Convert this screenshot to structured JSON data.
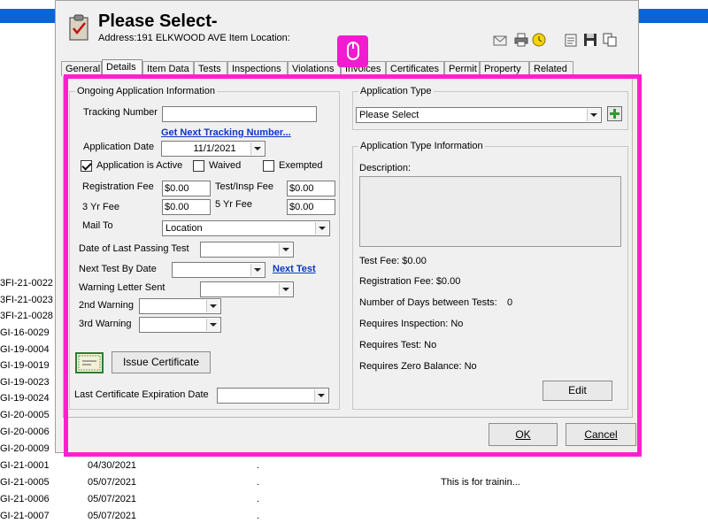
{
  "dialog": {
    "title": "Please Select-",
    "address_line": "Address:191 ELKWOOD AVE Item Location:",
    "tabs": [
      "General",
      "Details",
      "Item Data",
      "Tests",
      "Inspections",
      "Violations",
      "Invoices",
      "Certificates",
      "Permit",
      "Property",
      "Related"
    ],
    "active_tab": "Details",
    "ok_label": "OK",
    "cancel_label": "Cancel"
  },
  "ongoing": {
    "legend": "Ongoing Application Information",
    "tracking_number_label": "Tracking Number",
    "tracking_number_value": "",
    "next_tracking_link": "Get Next Tracking Number...",
    "application_date_label": "Application Date",
    "application_date_value": "11/1/2021",
    "active_label": "Application is Active",
    "active_checked": true,
    "waived_label": "Waived",
    "exempted_label": "Exempted",
    "registration_fee_label": "Registration Fee",
    "registration_fee_value": "$0.00",
    "test_insp_fee_label": "Test/Insp  Fee",
    "test_insp_fee_value": "$0.00",
    "three_yr_fee_label": "3 Yr Fee",
    "three_yr_fee_value": "$0.00",
    "five_yr_fee_label": "5 Yr Fee",
    "five_yr_fee_value": "$0.00",
    "mail_to_label": "Mail To",
    "mail_to_value": "Location",
    "last_passing_label": "Date of Last Passing Test",
    "next_test_label": "Next Test By Date",
    "next_test_link": "Next Test",
    "warning_letter_label": "Warning Letter Sent",
    "second_warning_label": "2nd Warning",
    "third_warning_label": "3rd Warning",
    "issue_certificate_label": "Issue Certificate",
    "last_cert_exp_label": "Last Certificate Expiration Date"
  },
  "app_type": {
    "legend": "Application Type",
    "value": "Please Select"
  },
  "app_type_info": {
    "legend": "Application Type Information",
    "description_label": "Description:",
    "test_fee": "Test Fee: $0.00",
    "registration_fee": "Registration Fee:  $0.00",
    "days_between": "Number of Days between Tests:",
    "days_between_value": "0",
    "requires_inspection": "Requires Inspection:  No",
    "requires_test": "Requires Test: No",
    "requires_zero_balance": "Requires Zero Balance: No",
    "edit_label": "Edit"
  },
  "background_rows": [
    {
      "id": "3FI-21-0022",
      "date": "",
      "dot": "",
      "note": ""
    },
    {
      "id": "3FI-21-0023",
      "date": "",
      "dot": "",
      "note": ""
    },
    {
      "id": "3FI-21-0028",
      "date": "",
      "dot": "",
      "note": ""
    },
    {
      "id": "GI-16-0029",
      "date": "",
      "dot": "",
      "note": ""
    },
    {
      "id": "GI-19-0004",
      "date": "",
      "dot": "",
      "note": ""
    },
    {
      "id": "GI-19-0019",
      "date": "",
      "dot": "",
      "note": ""
    },
    {
      "id": "GI-19-0023",
      "date": "",
      "dot": "",
      "note": ""
    },
    {
      "id": "GI-19-0024",
      "date": "",
      "dot": "",
      "note": ""
    },
    {
      "id": "GI-20-0005",
      "date": "",
      "dot": "",
      "note": ""
    },
    {
      "id": "GI-20-0006",
      "date": "",
      "dot": "",
      "note": ""
    },
    {
      "id": "GI-20-0009",
      "date": "",
      "dot": "",
      "note": ""
    },
    {
      "id": "GI-21-0001",
      "date": "04/30/2021",
      "dot": ".",
      "note": ""
    },
    {
      "id": "GI-21-0005",
      "date": "05/07/2021",
      "dot": ".",
      "note": "This is for trainin..."
    },
    {
      "id": "GI-21-0006",
      "date": "05/07/2021",
      "dot": ".",
      "note": ""
    },
    {
      "id": "GI-21-0007",
      "date": "05/07/2021",
      "dot": ".",
      "note": ""
    }
  ],
  "colors": {
    "highlight": "#ff1fd0",
    "link": "#0b36c9",
    "app_bar": "#0a64d8"
  }
}
